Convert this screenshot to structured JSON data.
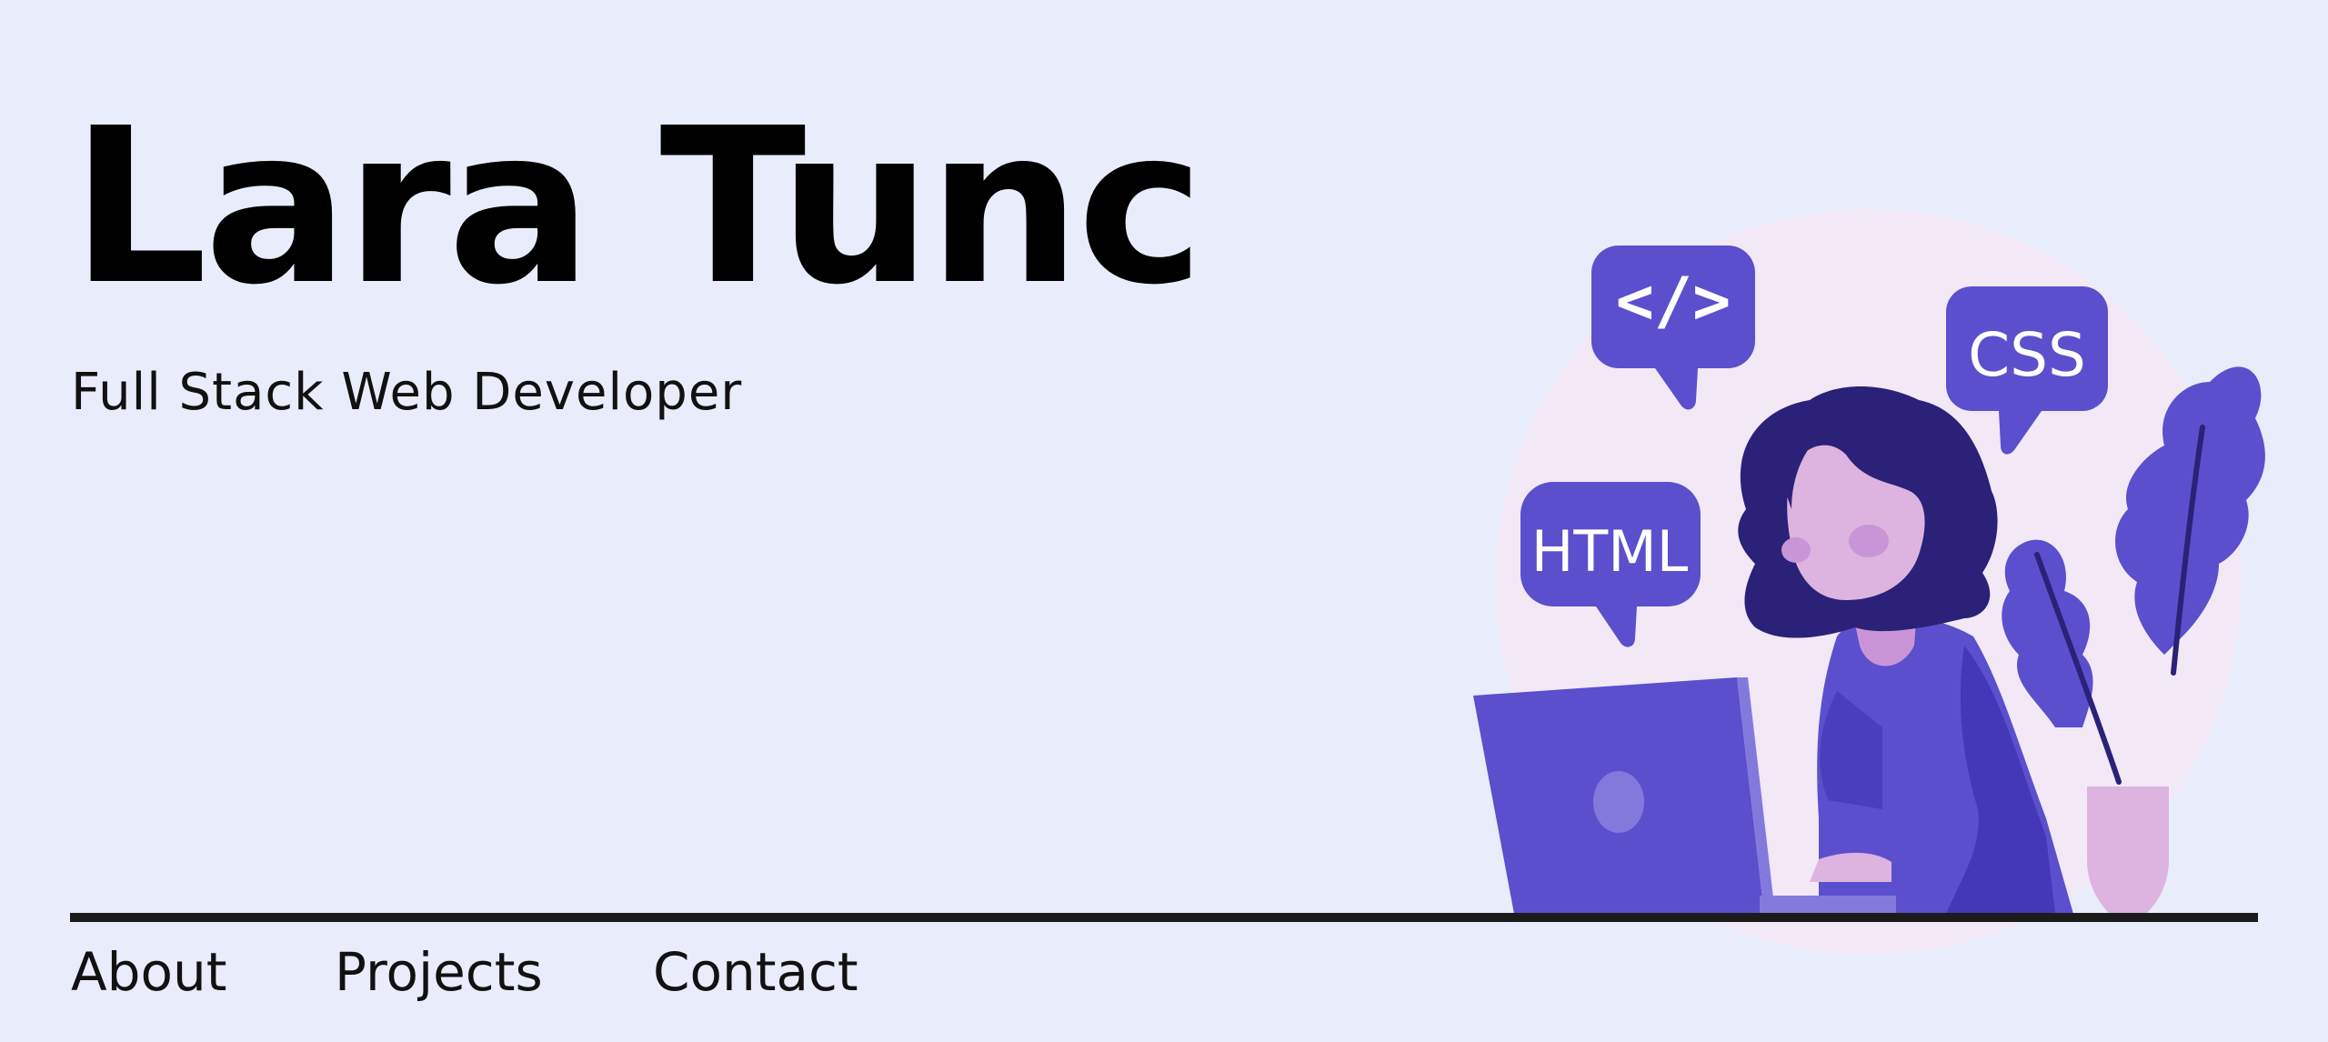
{
  "hero": {
    "name": "Lara Tunc",
    "role": "Full Stack Web Developer"
  },
  "illustration": {
    "bubble_code": "</>",
    "bubble_css": "CSS",
    "bubble_html": "HTML",
    "icons": [
      "developer-illustration",
      "code-bubble-icon",
      "css-bubble-icon",
      "html-bubble-icon",
      "laptop-icon",
      "plant-icon"
    ]
  },
  "nav": {
    "items": [
      {
        "label": "About"
      },
      {
        "label": "Projects"
      },
      {
        "label": "Contact"
      }
    ]
  },
  "colors": {
    "background": "#e9ecfa",
    "accent": "#5b4fcd",
    "accent_dark": "#2b2178",
    "skin": "#dcb4df",
    "circle": "#f2e8f6",
    "divider": "#1b1b1b"
  }
}
